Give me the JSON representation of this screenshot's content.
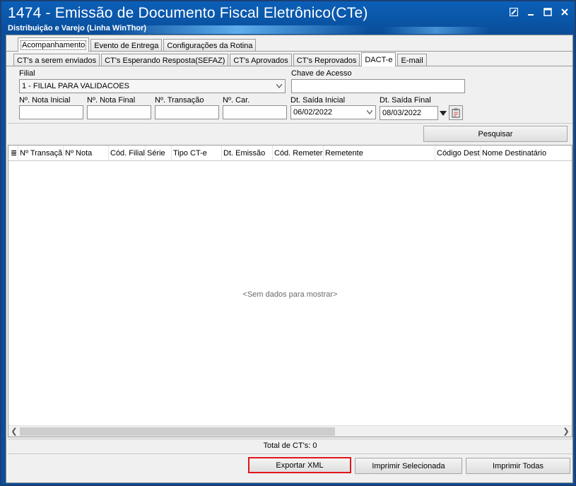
{
  "window": {
    "title": "1474 - Emissão de Documento Fiscal Eletrônico(CTe)",
    "subtitle": "Distribuição e Varejo (Linha WinThor)"
  },
  "tabs_main": [
    {
      "label": "Acompanhamento",
      "active": true
    },
    {
      "label": "Evento de Entrega",
      "active": false
    },
    {
      "label": "Configurações da Rotina",
      "active": false
    }
  ],
  "tabs_sub": [
    {
      "label": "CT's a serem enviados",
      "active": false
    },
    {
      "label": "CT's Esperando Resposta(SEFAZ)",
      "active": false
    },
    {
      "label": "CT's Aprovados",
      "active": false
    },
    {
      "label": "CT's Reprovados",
      "active": false
    },
    {
      "label": "DACT-e",
      "active": true
    },
    {
      "label": "E-mail",
      "active": false
    }
  ],
  "filters": {
    "filial_label": "Filial",
    "filial_value": "1 - FILIAL PARA VALIDACOES",
    "chave_label": "Chave de Acesso",
    "chave_value": "",
    "nota_inicial_label": "Nº. Nota Inicial",
    "nota_final_label": "Nº. Nota Final",
    "transacao_label": "Nº. Transação",
    "car_label": "Nº. Car.",
    "dt_inicial_label": "Dt. Saída Inicial",
    "dt_inicial_value": "06/02/2022",
    "dt_final_label": "Dt. Saída Final",
    "dt_final_value": "08/03/2022",
    "pesquisar_label": "Pesquisar"
  },
  "grid": {
    "columns": [
      "Nº Transaçã",
      "Nº Nota",
      "Cód. Filial",
      "Série",
      "Tipo CT-e",
      "Dt. Emissão",
      "Cód. Remeter",
      "Remetente",
      "Código Dest",
      "Nome Destinatário"
    ],
    "empty_message": "<Sem dados para mostrar>"
  },
  "footer": {
    "total_text": "Total de CT's: 0",
    "exportar_label": "Exportar XML",
    "imprimir_sel_label": "Imprimir Selecionada",
    "imprimir_todas_label": "Imprimir Todas"
  },
  "colors": {
    "titlebar": "#0a56a8",
    "highlight": "#e0161b"
  }
}
